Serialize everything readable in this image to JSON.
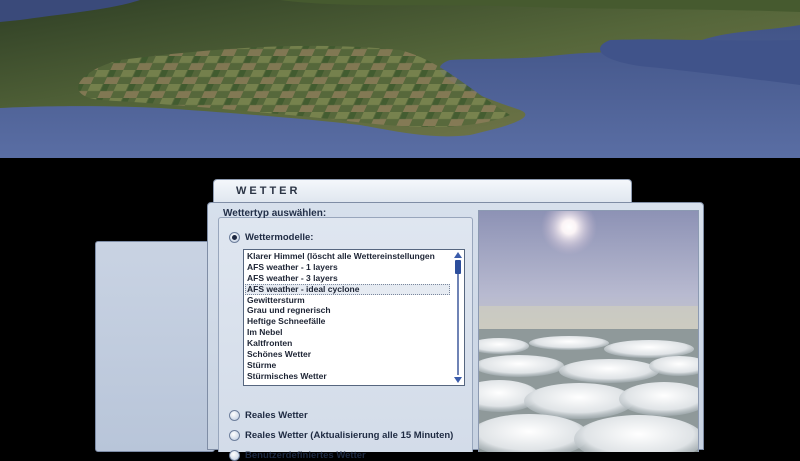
{
  "dialog": {
    "title": "WETTER",
    "section_label": "Wettertyp auswählen:"
  },
  "options": {
    "weather_models": {
      "label": "Wettermodelle:",
      "selected": true
    },
    "real_weather": {
      "label": "Reales Wetter",
      "selected": false
    },
    "real_weather_update": {
      "label": "Reales Wetter (Aktualisierung alle 15 Minuten)",
      "selected": false
    },
    "custom_weather": {
      "label": "Benutzerdefiniertes Wetter",
      "selected": false
    }
  },
  "weather_list": {
    "items": [
      "Klarer Himmel (löscht alle Wettereinstellungen",
      "AFS weather - 1 layers",
      "AFS weather - 3 layers",
      "AFS weather - ideal cyclone",
      "Gewittersturm",
      "Grau und regnerisch",
      "Heftige Schneefälle",
      "Im Nebel",
      "Kaltfronten",
      "Schönes Wetter",
      "Stürme",
      "Stürmisches Wetter"
    ],
    "selected_index": 3
  },
  "icons": {
    "scroll_up": "triangle-up",
    "scroll_down": "triangle-down"
  },
  "colors": {
    "dialog_bg": "#d3dce9",
    "scrollbar": "#2d4e9c",
    "selection": "#e6ebf2"
  }
}
